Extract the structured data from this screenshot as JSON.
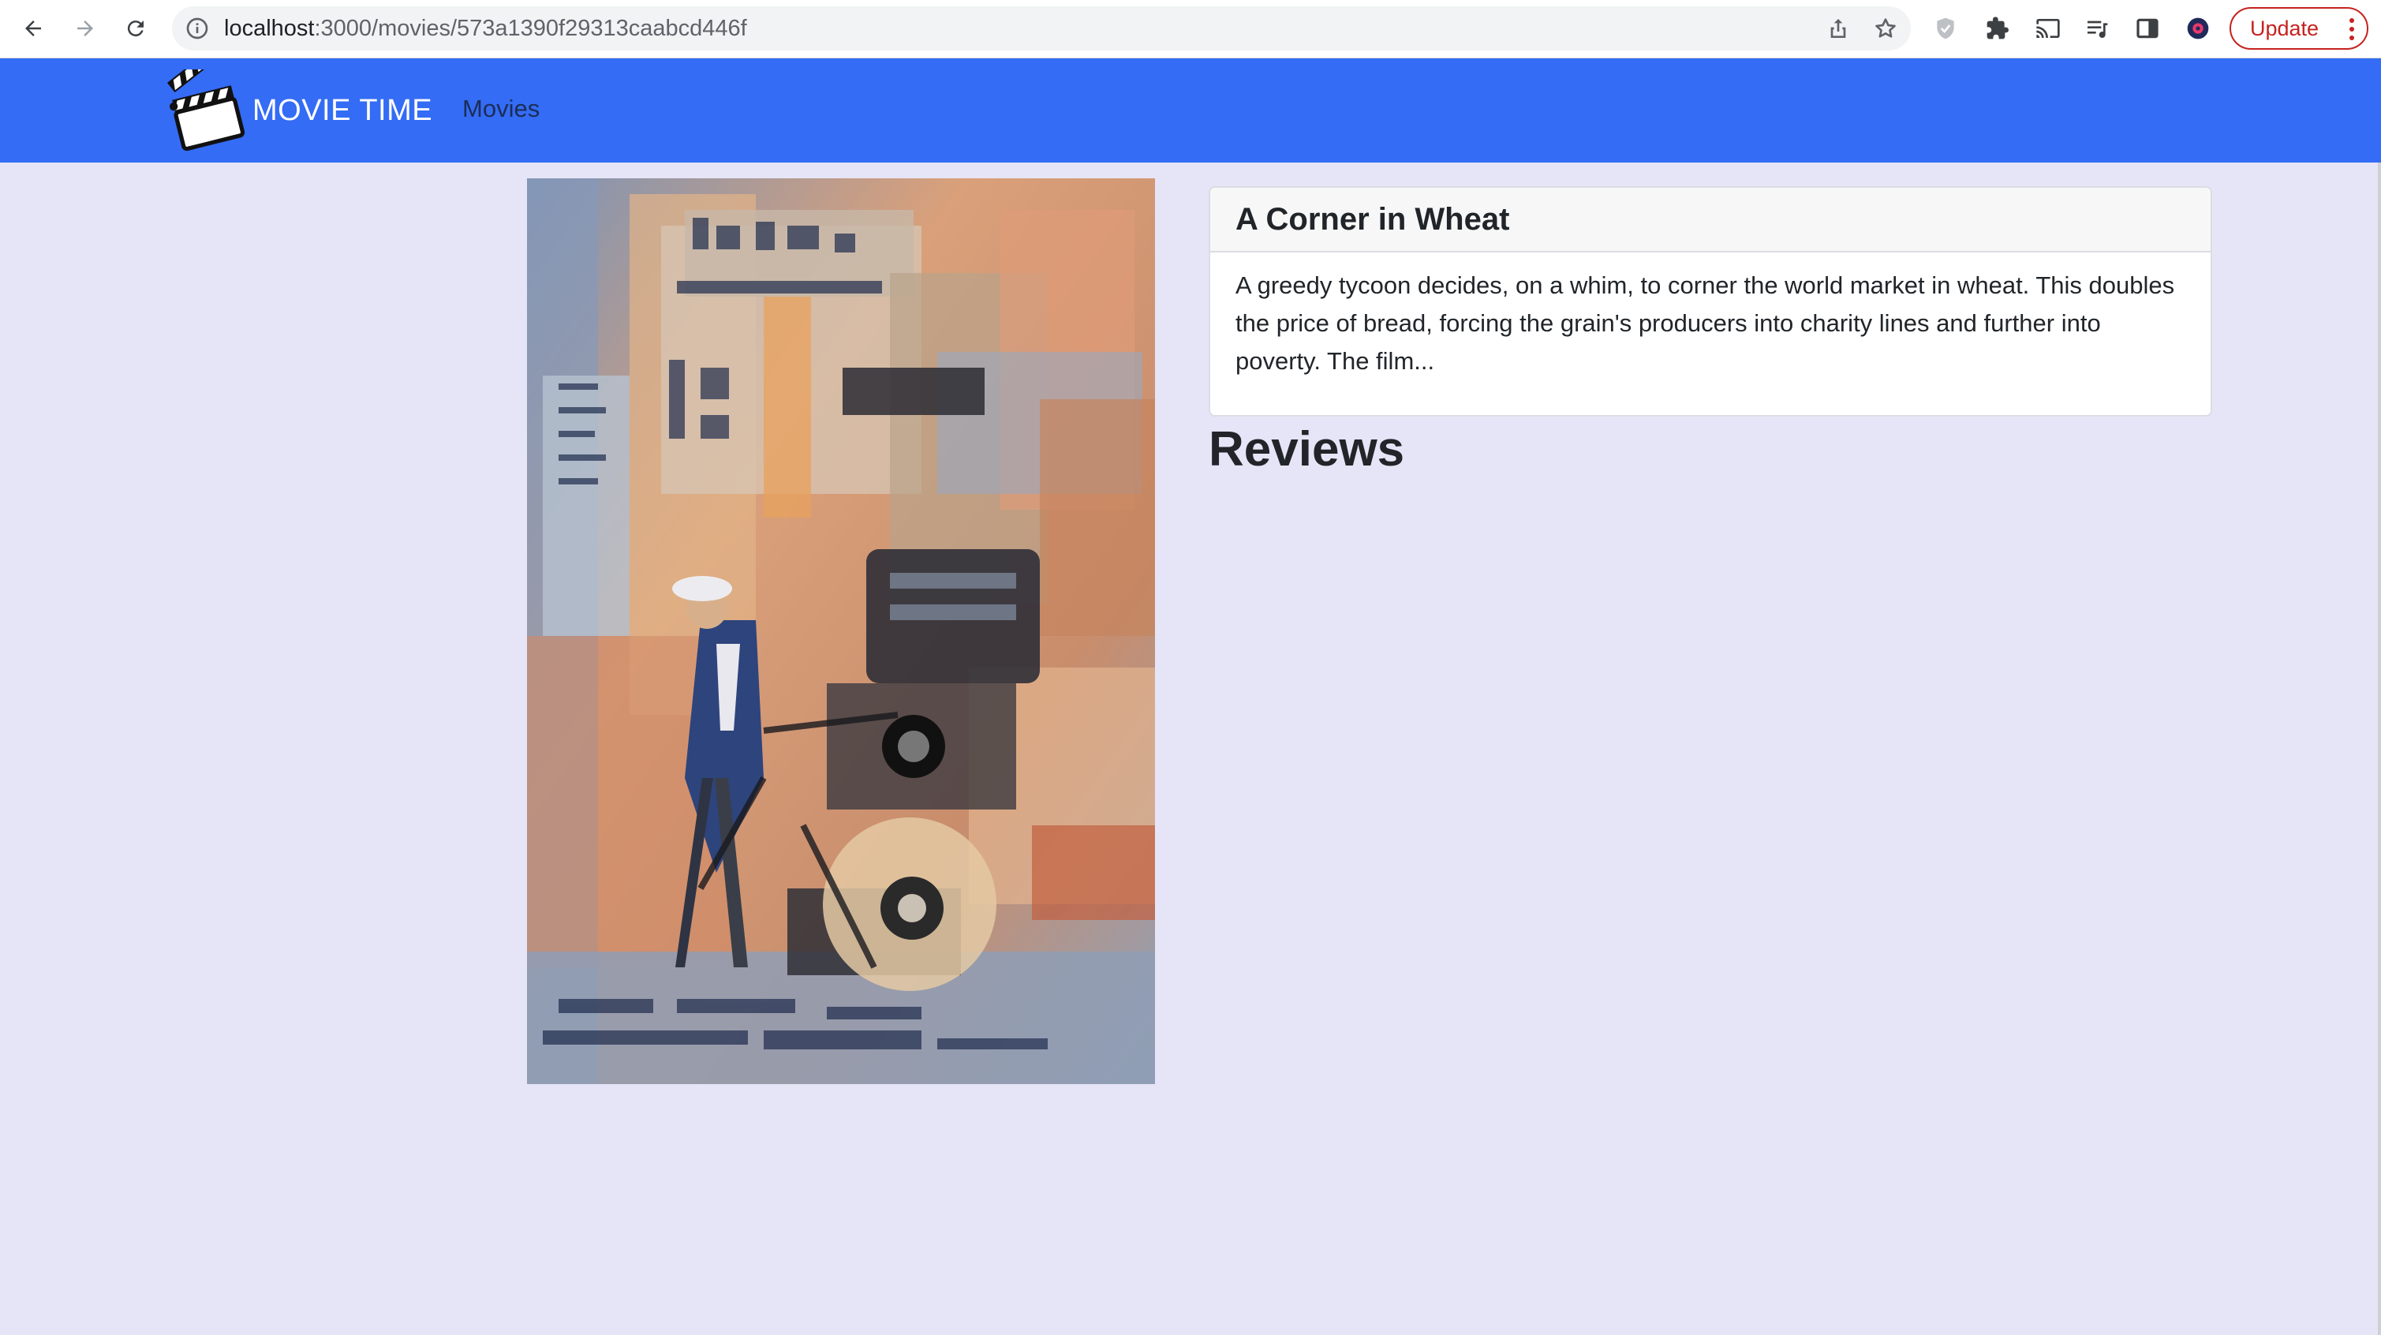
{
  "browser": {
    "url_host": "localhost",
    "url_path": ":3000/movies/573a1390f29313caabcd446f",
    "update_label": "Update",
    "toolbar_icons": [
      "back-icon",
      "forward-icon",
      "reload-icon",
      "site-info-icon",
      "share-icon",
      "bookmark-star-icon",
      "shield-extension-icon",
      "puzzle-extensions-icon",
      "cast-icon",
      "reading-list-icon",
      "side-panel-icon",
      "profile-avatar-icon",
      "more-vert-icon"
    ]
  },
  "navbar": {
    "brand": "MOVIE TIME",
    "links": [
      {
        "label": "Movies"
      }
    ],
    "color": "#346cf5"
  },
  "movie": {
    "title": "A Corner in Wheat",
    "plot": "A greedy tycoon decides, on a whim, to corner the world market in wheat. This doubles the price of bread, forcing the grain's producers into charity lines and further into poverty. The film..."
  },
  "reviews": {
    "heading": "Reviews"
  }
}
